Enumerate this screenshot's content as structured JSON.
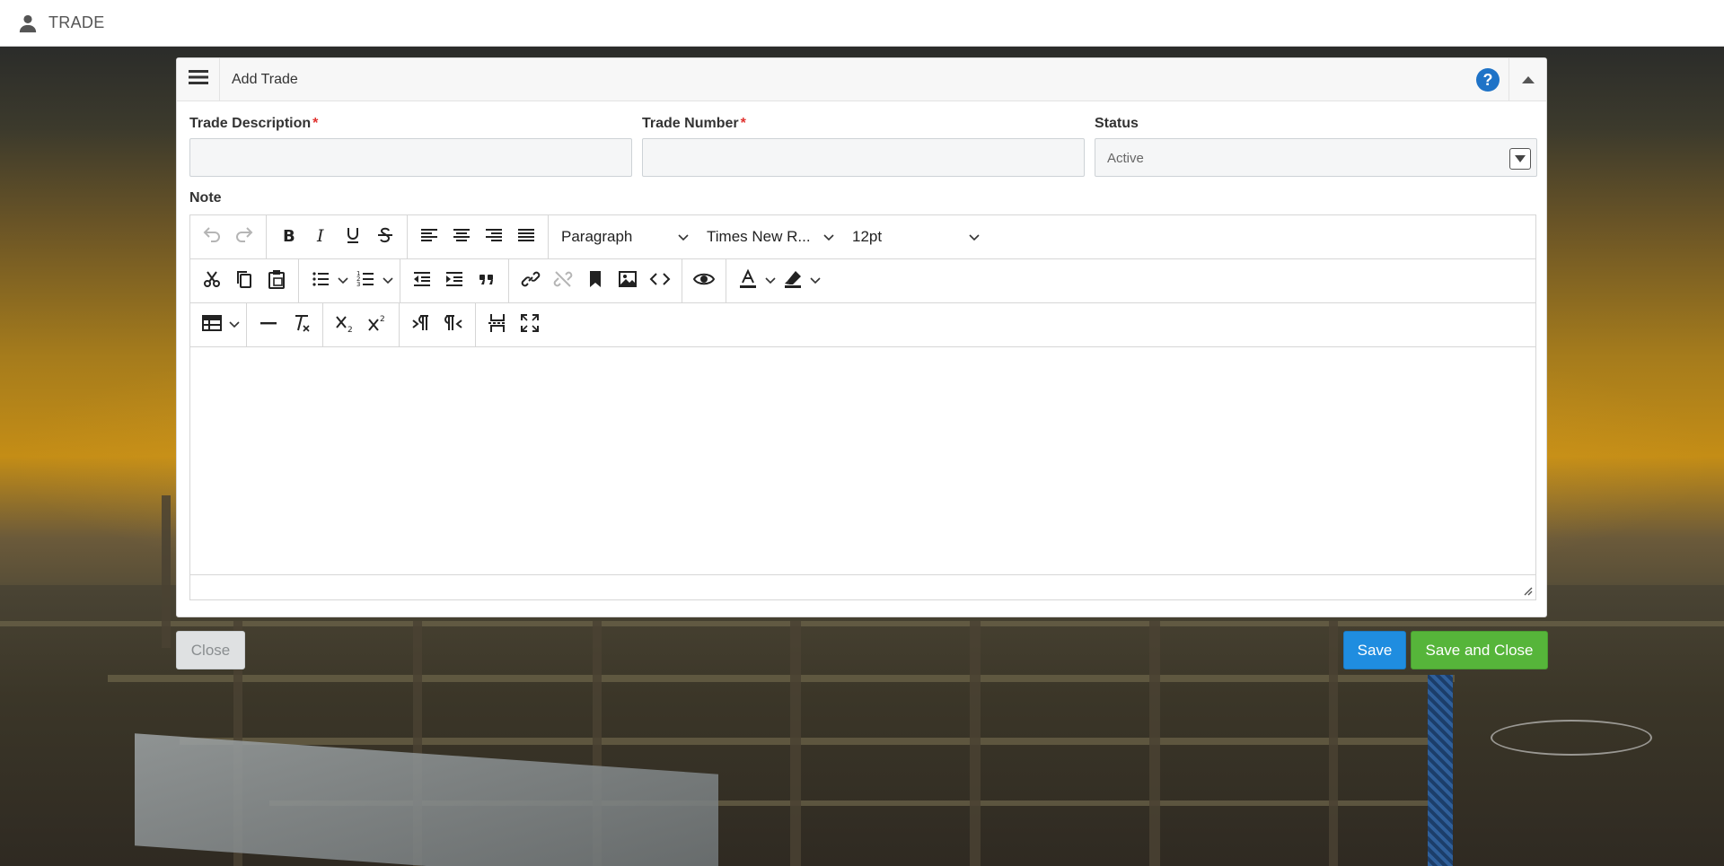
{
  "app": {
    "title": "TRADE",
    "icon": "user-icon"
  },
  "panel": {
    "title": "Add Trade",
    "menu_icon": "hamburger-icon",
    "help_icon": "help-icon",
    "collapse_icon": "chevron-up-icon"
  },
  "form": {
    "trade_description": {
      "label": "Trade Description",
      "required_mark": "*",
      "value": ""
    },
    "trade_number": {
      "label": "Trade Number",
      "required_mark": "*",
      "value": ""
    },
    "status": {
      "label": "Status",
      "value": "Active"
    },
    "note": {
      "label": "Note",
      "value": ""
    }
  },
  "toolbar": {
    "block_format": "Paragraph",
    "font_family": "Times New R...",
    "font_size": "12pt"
  },
  "buttons": {
    "close": "Close",
    "save": "Save",
    "save_and_close": "Save and Close"
  },
  "colors": {
    "save": "#1f8de0",
    "save_and_close": "#56b53a",
    "help": "#1f73c7",
    "required": "#e0322f"
  }
}
